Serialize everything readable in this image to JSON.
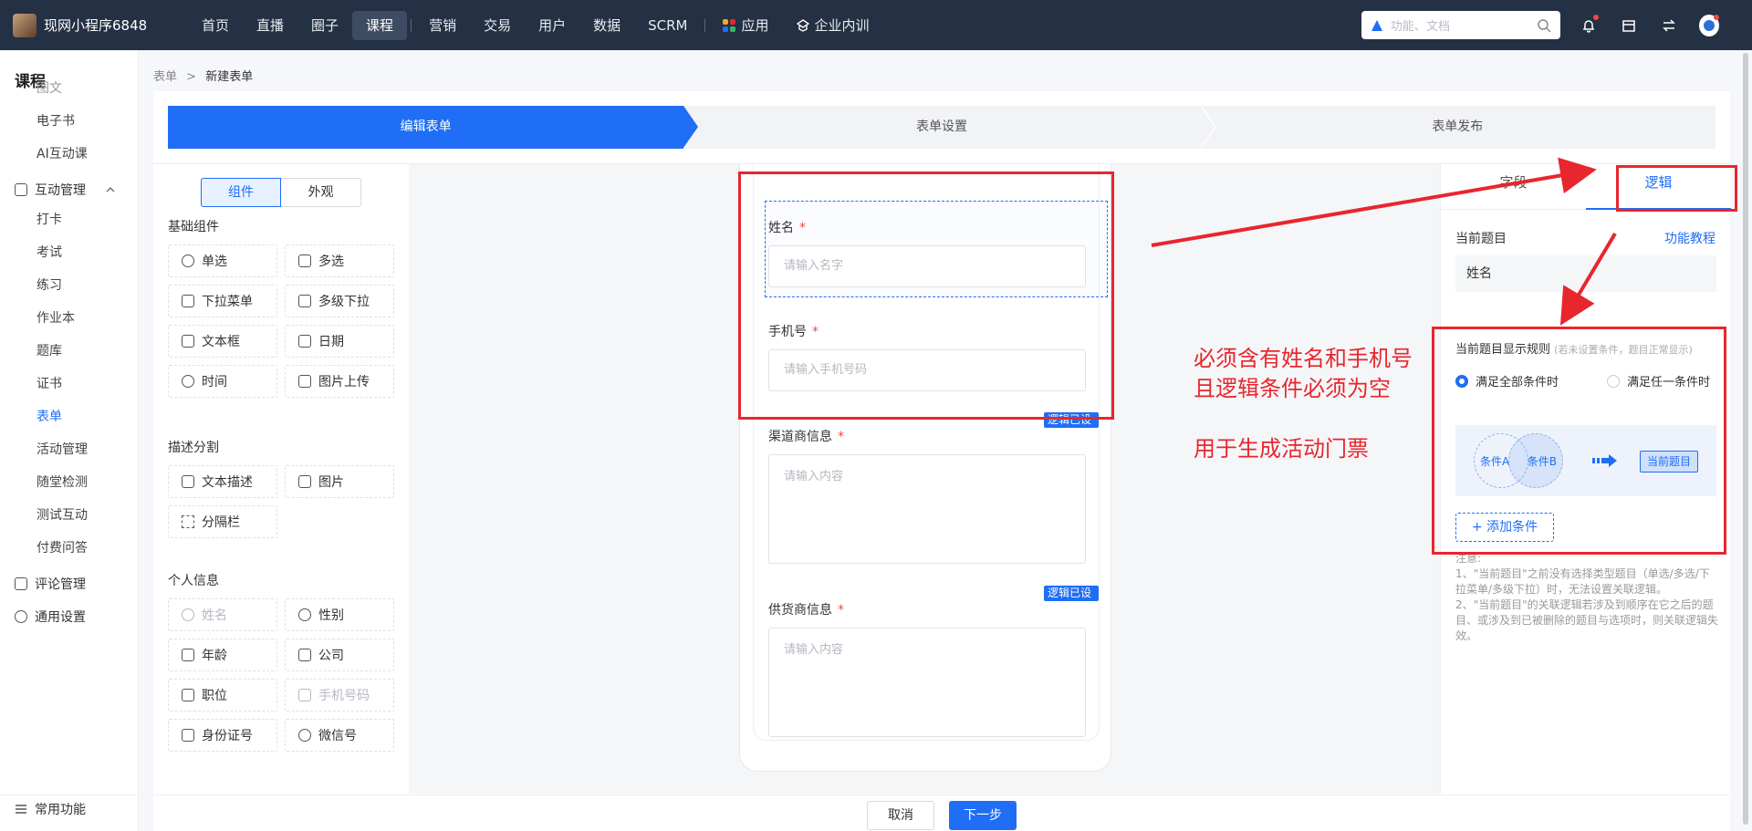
{
  "topnav": {
    "brand": "现网小程序6848",
    "items": [
      {
        "label": "首页",
        "active": false
      },
      {
        "label": "直播",
        "active": false
      },
      {
        "label": "圈子",
        "active": false
      },
      {
        "label": "课程",
        "active": true
      },
      {
        "label": "营销",
        "active": false
      },
      {
        "label": "交易",
        "active": false
      },
      {
        "label": "用户",
        "active": false
      },
      {
        "label": "数据",
        "active": false
      },
      {
        "label": "SCRM",
        "active": false
      },
      {
        "label": "应用",
        "active": false
      },
      {
        "label": "企业内训",
        "active": false
      }
    ],
    "search_placeholder": "功能、文档",
    "icons": [
      "bell-icon",
      "store-icon",
      "switch-icon",
      "avatar"
    ]
  },
  "sidebar": {
    "title": "课程",
    "items": [
      {
        "label": "图文",
        "type": "item"
      },
      {
        "label": "电子书",
        "type": "item"
      },
      {
        "label": "AI互动课",
        "type": "item"
      },
      {
        "label": "互动管理",
        "type": "group"
      },
      {
        "label": "打卡",
        "type": "item"
      },
      {
        "label": "考试",
        "type": "item"
      },
      {
        "label": "练习",
        "type": "item"
      },
      {
        "label": "作业本",
        "type": "item"
      },
      {
        "label": "题库",
        "type": "item"
      },
      {
        "label": "证书",
        "type": "item"
      },
      {
        "label": "表单",
        "type": "item",
        "active": true
      },
      {
        "label": "活动管理",
        "type": "item"
      },
      {
        "label": "随堂检测",
        "type": "item"
      },
      {
        "label": "测试互动",
        "type": "item"
      },
      {
        "label": "付费问答",
        "type": "item"
      },
      {
        "label": "评论管理",
        "type": "group"
      },
      {
        "label": "通用设置",
        "type": "group"
      },
      {
        "label": "常用功能",
        "type": "group"
      }
    ]
  },
  "breadcrumb": {
    "parent": "表单",
    "separator": ">",
    "current": "新建表单"
  },
  "steps": [
    "编辑表单",
    "表单设置",
    "表单发布"
  ],
  "components": {
    "tabs": [
      "组件",
      "外观"
    ],
    "sections": [
      {
        "title": "基础组件",
        "items": [
          {
            "label": "单选",
            "icon": "radio-icon"
          },
          {
            "label": "多选",
            "icon": "checkbox-icon"
          },
          {
            "label": "下拉菜单",
            "icon": "dropdown-icon"
          },
          {
            "label": "多级下拉",
            "icon": "multi-dropdown-icon"
          },
          {
            "label": "文本框",
            "icon": "text-icon"
          },
          {
            "label": "日期",
            "icon": "calendar-icon"
          },
          {
            "label": "时间",
            "icon": "clock-icon"
          },
          {
            "label": "图片上传",
            "icon": "image-upload-icon"
          }
        ]
      },
      {
        "title": "描述分割",
        "items": [
          {
            "label": "文本描述",
            "icon": "description-icon"
          },
          {
            "label": "图片",
            "icon": "image-icon"
          },
          {
            "label": "分隔栏",
            "icon": "divider-icon"
          }
        ]
      },
      {
        "title": "个人信息",
        "items": [
          {
            "label": "姓名",
            "icon": "person-icon",
            "disabled": true
          },
          {
            "label": "性别",
            "icon": "gender-icon"
          },
          {
            "label": "年龄",
            "icon": "cake-icon"
          },
          {
            "label": "公司",
            "icon": "briefcase-icon"
          },
          {
            "label": "职位",
            "icon": "tie-icon"
          },
          {
            "label": "手机号码",
            "icon": "phone-icon",
            "disabled": true
          },
          {
            "label": "身份证号",
            "icon": "id-card-icon"
          },
          {
            "label": "微信号",
            "icon": "wechat-icon"
          }
        ]
      }
    ]
  },
  "form": {
    "fields": [
      {
        "label": "姓名",
        "required": "*",
        "placeholder": "请输入名字",
        "selected": true
      },
      {
        "label": "手机号",
        "required": "*",
        "placeholder": "请输入手机号码"
      },
      {
        "label": "渠道商信息",
        "required": "*",
        "placeholder": "请输入内容",
        "tag": "逻辑已设置"
      },
      {
        "label": "供货商信息",
        "required": "*",
        "placeholder": "请输入内容",
        "tag": "逻辑已设置"
      }
    ]
  },
  "right_panel": {
    "tabs": [
      "字段",
      "逻辑"
    ],
    "active_tab": "逻辑",
    "current_label": "当前题目",
    "tutorial_link": "功能教程",
    "current_value": "姓名",
    "rule_title": "当前题目显示规则",
    "rule_hint": "(若未设置条件，题目正常显示)",
    "options": [
      {
        "label": "满足全部条件时",
        "checked": true
      },
      {
        "label": "满足任一条件时",
        "checked": false
      }
    ],
    "venn": {
      "a": "条件A",
      "b": "条件B",
      "result": "当前题目"
    },
    "add_button": "+ 添加条件",
    "note_title": "注意:",
    "notes": [
      "1、\"当前题目\"之前没有选择类型题目（单选/多选/下拉菜单/多级下拉）时，无法设置关联逻辑。",
      "2、\"当前题目\"的关联逻辑若涉及到顺序在它之后的题目、或涉及到已被删除的题目与选项时，则关联逻辑失效。"
    ]
  },
  "bottom": {
    "cancel": "取消",
    "next": "下一步"
  },
  "annotation": {
    "lines": [
      "必须含有姓名和手机号",
      "且逻辑条件必须为空",
      "",
      "用于生成活动门票"
    ],
    "color": "#e8262d"
  },
  "colors": {
    "primary": "#1f6ef5",
    "nav_bg": "#243043",
    "annotation": "#e8262d"
  }
}
